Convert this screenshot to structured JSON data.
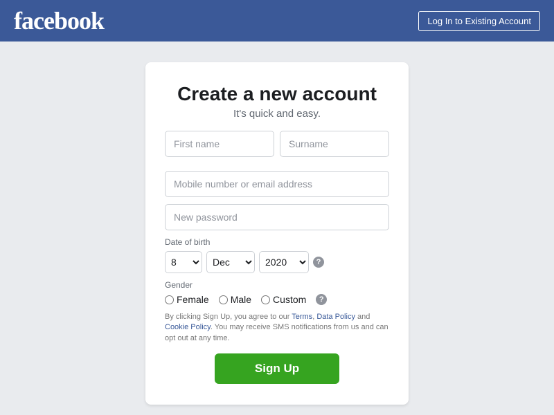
{
  "header": {
    "logo": "facebook",
    "login_button_label": "Log In to Existing Account"
  },
  "form": {
    "heading": "Create a new account",
    "subheading": "It's quick and easy.",
    "first_name_placeholder": "First name",
    "surname_placeholder": "Surname",
    "email_placeholder": "Mobile number or email address",
    "password_placeholder": "New password",
    "dob_label": "Date of birth",
    "dob_day_value": "8",
    "dob_month_value": "Dec",
    "dob_year_value": "2020",
    "gender_label": "Gender",
    "gender_options": [
      {
        "id": "female",
        "label": "Female"
      },
      {
        "id": "male",
        "label": "Male"
      },
      {
        "id": "custom",
        "label": "Custom"
      }
    ],
    "terms_text": "By clicking Sign Up, you agree to our Terms, Data Policy and Cookie Policy. You may receive SMS notifications from us and can opt out at any time.",
    "terms_link": "Terms",
    "data_policy_link": "Data Policy",
    "cookie_policy_link": "Cookie Policy",
    "signup_button_label": "Sign Up"
  }
}
